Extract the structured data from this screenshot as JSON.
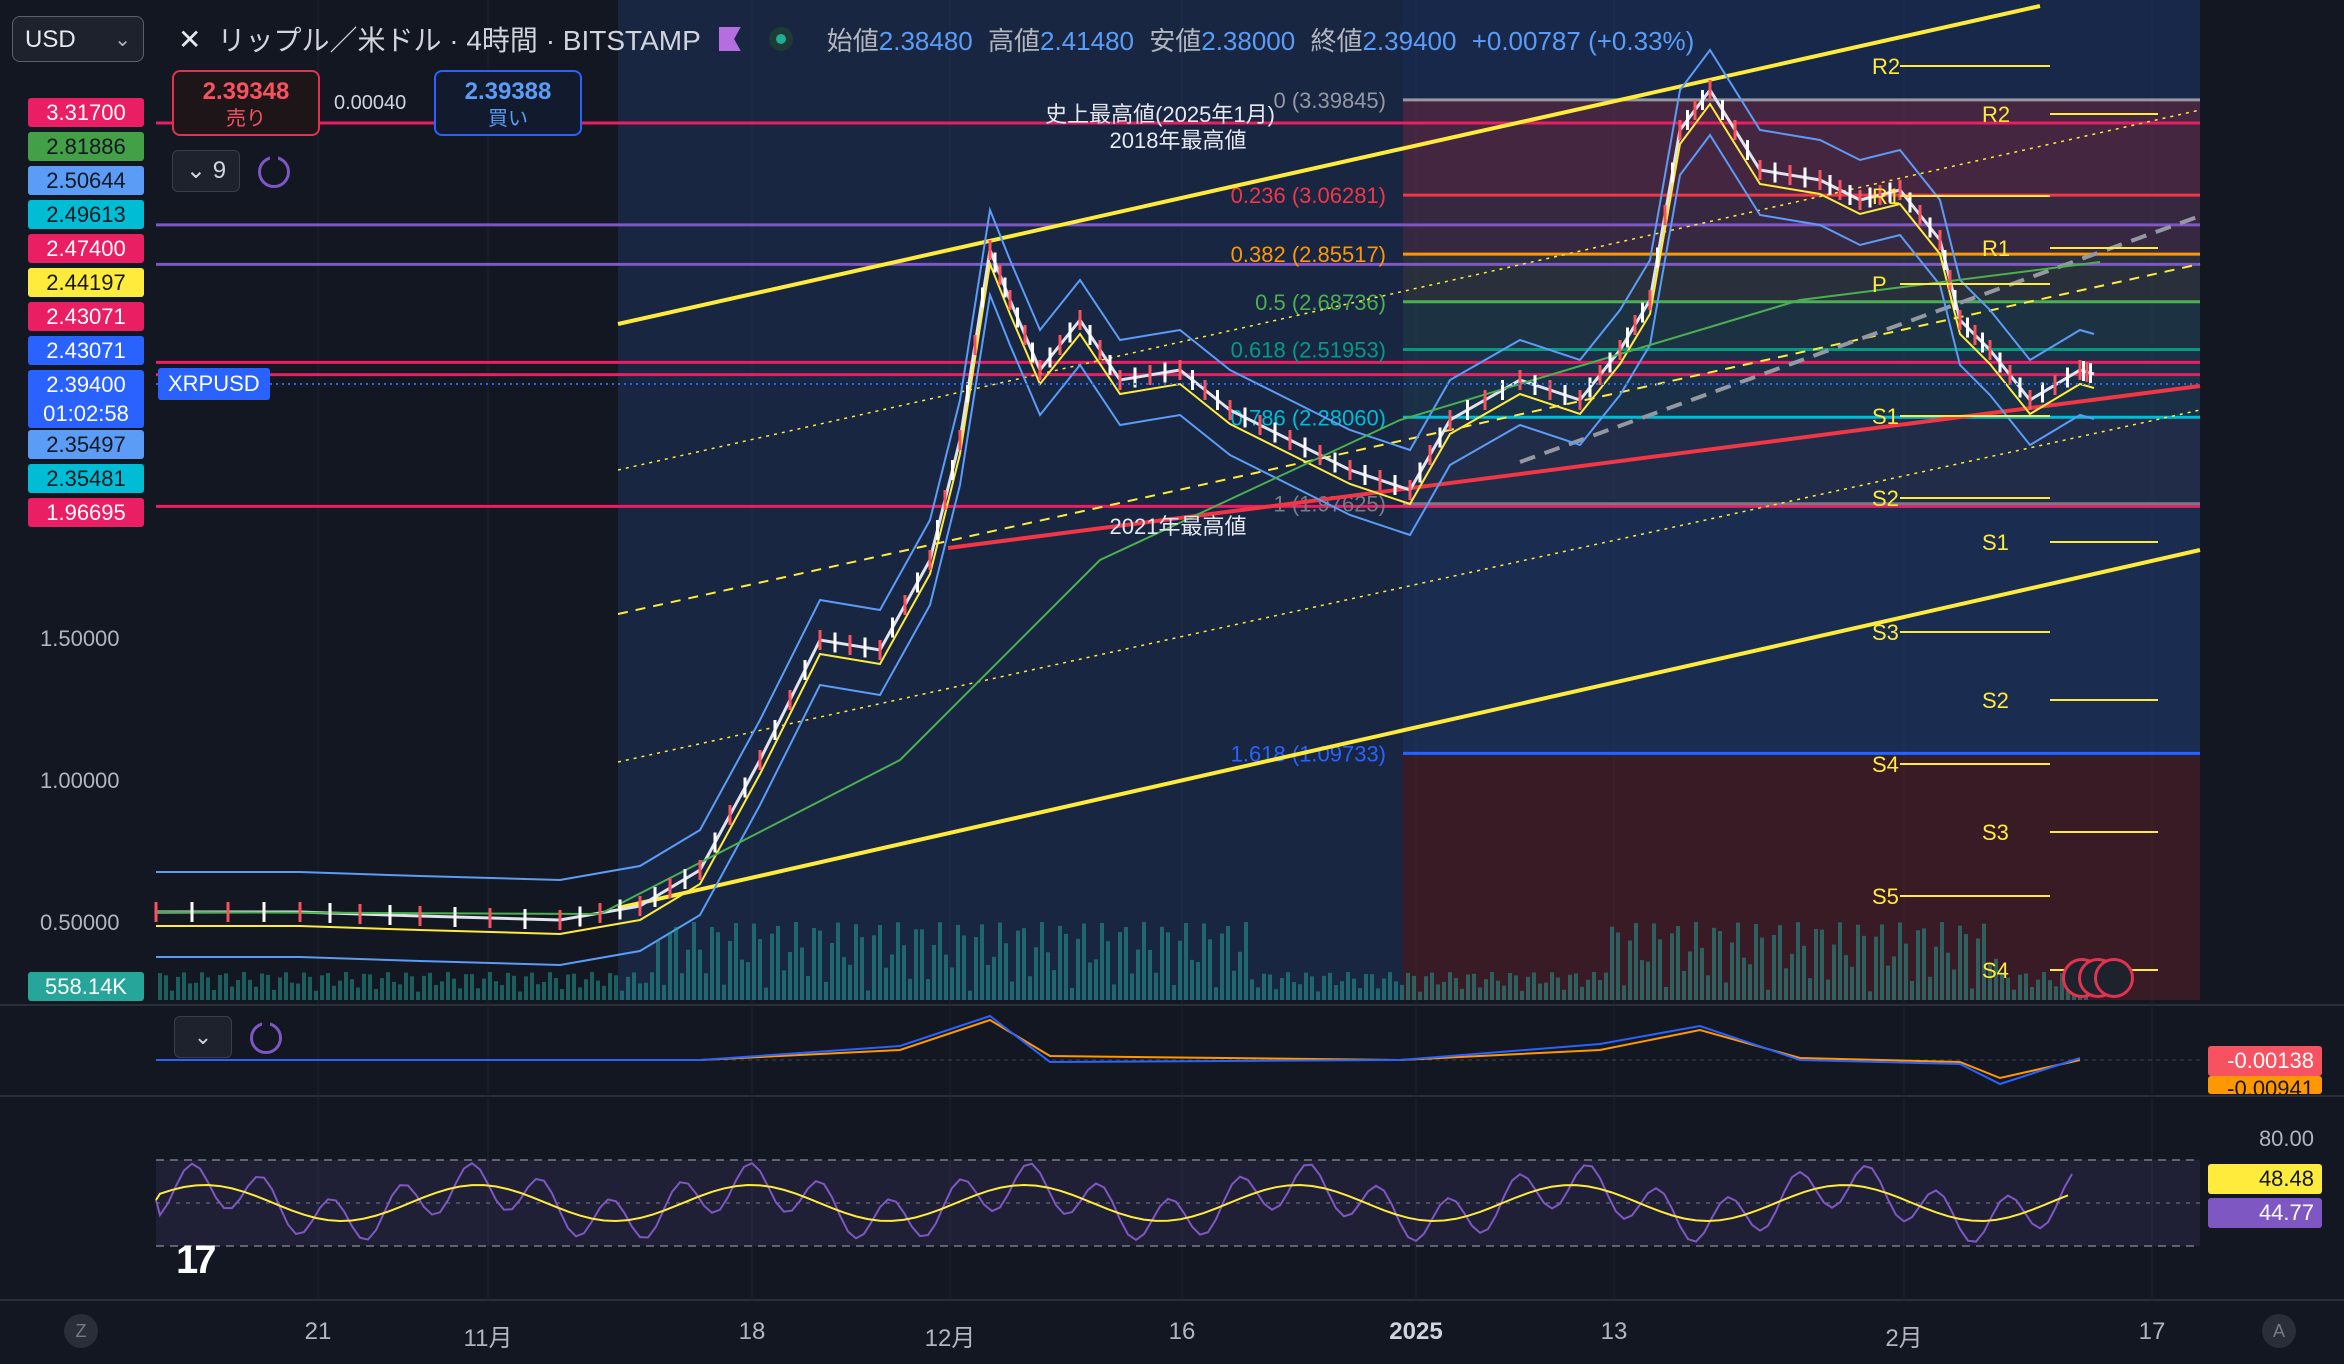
{
  "top_bar": {
    "currency_select": "USD",
    "symbol_title": "リップル／米ドル · 4時間 · BITSTAMP",
    "close_icon": "x-icon",
    "flag_icon": "flag-icon",
    "live_icon": "live-dot-icon",
    "ohlc": {
      "open_label": "始値",
      "open": "2.38480",
      "high_label": "高値",
      "high": "2.41480",
      "low_label": "安値",
      "low": "2.38000",
      "close_label": "終値",
      "close": "2.39400",
      "change": "+0.00787 (+0.33%)"
    }
  },
  "trade": {
    "sell_price": "2.39348",
    "sell_label": "売り",
    "spread": "0.00040",
    "buy_price": "2.39388",
    "buy_label": "買い"
  },
  "indicator_button": {
    "count": "9",
    "chevron": "chevron-down-icon"
  },
  "price_axis_labels": [
    {
      "value": "3.31700",
      "color": "#e91e63"
    },
    {
      "value": "2.81886",
      "color": "#43a047"
    },
    {
      "value": "2.50644",
      "color": "#5b9cf6"
    },
    {
      "value": "2.49613",
      "color": "#00bcd4"
    },
    {
      "value": "2.47400",
      "color": "#e91e63"
    },
    {
      "value": "2.44197",
      "color": "#ffeb3b"
    },
    {
      "value": "2.43071",
      "color": "#e91e63"
    },
    {
      "value": "2.43071",
      "color": "#2962ff"
    },
    {
      "value": "2.39400",
      "color": "#2962ff",
      "sub": "01:02:58"
    },
    {
      "value": "2.35497",
      "color": "#5b9cf6"
    },
    {
      "value": "2.35481",
      "color": "#00bcd4"
    },
    {
      "value": "1.96695",
      "color": "#e91e63"
    }
  ],
  "symbol_tag": "XRPUSD",
  "price_scale": [
    "1.50000",
    "1.00000",
    "0.50000"
  ],
  "volume_label": "558.14K",
  "fib_levels": [
    {
      "text": "0 (3.39845)",
      "color": "#9598a1",
      "price": 3.39845
    },
    {
      "text": "0.236 (3.06281)",
      "color": "#f23645",
      "price": 3.06281
    },
    {
      "text": "0.382 (2.85517)",
      "color": "#ff9800",
      "price": 2.85517
    },
    {
      "text": "0.5 (2.68736)",
      "color": "#4caf50",
      "price": 2.68736
    },
    {
      "text": "0.618 (2.51953)",
      "color": "#089981",
      "price": 2.51953
    },
    {
      "text": "0.786 (2.28060)",
      "color": "#00bcd4",
      "price": 2.2806
    },
    {
      "text": "1 (1.97625)",
      "color": "#787b86",
      "price": 1.97625
    },
    {
      "text": "1.618 (1.09733)",
      "color": "#2962ff",
      "price": 1.09733
    }
  ],
  "annotations": {
    "ath": "史上最高値(2025年1月)",
    "high_2018": "2018年最高値",
    "high_2021": "2021年最高値"
  },
  "pivots_a": [
    "R2",
    "R1",
    "P",
    "S1",
    "S2",
    "S3",
    "S4",
    "S5"
  ],
  "pivots_b": [
    "R2",
    "R1",
    "S1",
    "S2",
    "S3",
    "S4"
  ],
  "x_axis": [
    "21",
    "11月",
    "18",
    "12月",
    "16",
    "2025",
    "13",
    "2月",
    "17"
  ],
  "x_axis_bold": "2025",
  "x_buttons": [
    "Z",
    "A"
  ],
  "macd_values": [
    {
      "value": "-0.00138",
      "color": "#f7525f"
    },
    {
      "value": "-0.00941",
      "color": "#ff9800"
    }
  ],
  "rsi_values": [
    {
      "value": "80.00",
      "color": "none"
    },
    {
      "value": "48.48",
      "color": "#ffeb3b"
    },
    {
      "value": "44.77",
      "color": "#7e57c2"
    }
  ],
  "logo": "17",
  "colors": {
    "background": "#131722",
    "up": "#ffffff",
    "channel": "#ffeb3b",
    "support": "#f23645",
    "bollinger": "#5b9cf6"
  }
}
